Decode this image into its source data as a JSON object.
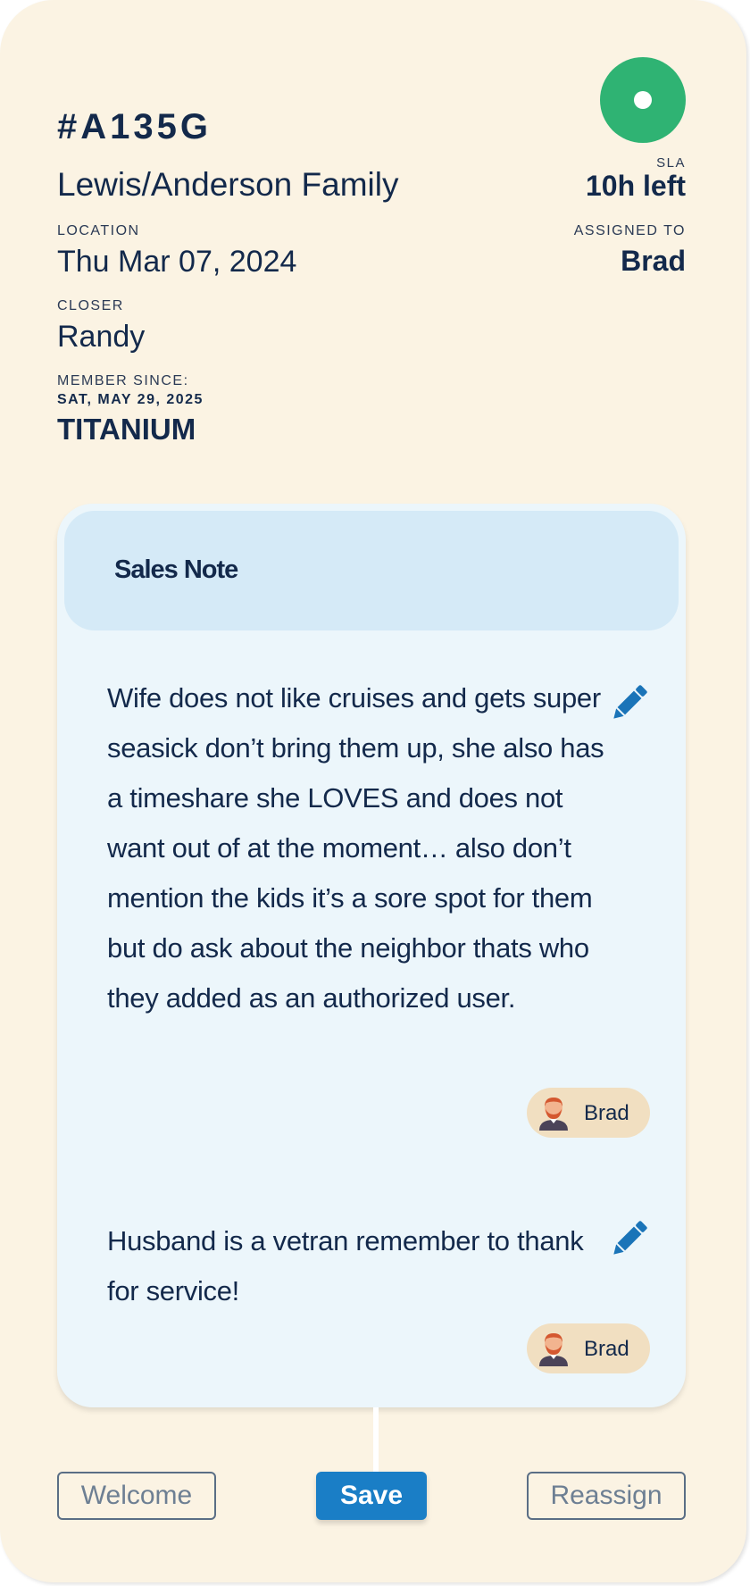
{
  "ticket": {
    "id": "#A135G",
    "family": "Lewis/Anderson Family",
    "status_color": "#2fb373"
  },
  "sla": {
    "label": "SLA",
    "value": "10h left"
  },
  "location": {
    "label": "LOCATION",
    "value": "Thu Mar 07, 2024"
  },
  "assigned": {
    "label": "ASSIGNED TO",
    "value": "Brad"
  },
  "closer": {
    "label": "CLOSER",
    "value": "Randy"
  },
  "member": {
    "label": "MEMBER SINCE:",
    "date": "SAT, MAY 29, 2025",
    "tier": "TITANIUM"
  },
  "notes": {
    "title": "Sales Note",
    "items": [
      {
        "text": "Wife does not like cruises and gets super seasick don’t bring them up, she also has a timeshare she LOVES and does not want out of at the moment… also don’t mention the kids it’s a sore spot for them but do ask about the neighbor thats who they added as an authorized user.",
        "author": "Brad",
        "edit_icon": "pencil-icon",
        "avatar_icon": "user-avatar-icon"
      },
      {
        "text": "Husband is a vetran remember to thank for service!",
        "author": "Brad",
        "edit_icon": "pencil-icon",
        "avatar_icon": "user-avatar-icon"
      }
    ]
  },
  "actions": {
    "welcome": "Welcome",
    "save": "Save",
    "reassign": "Reassign"
  },
  "colors": {
    "background": "#fbf3e3",
    "text": "#13294b",
    "accent": "#1a7ec6",
    "panel": "#ecf6fb",
    "panel_header": "#d5eaf7",
    "chip": "#f1dfc1"
  }
}
